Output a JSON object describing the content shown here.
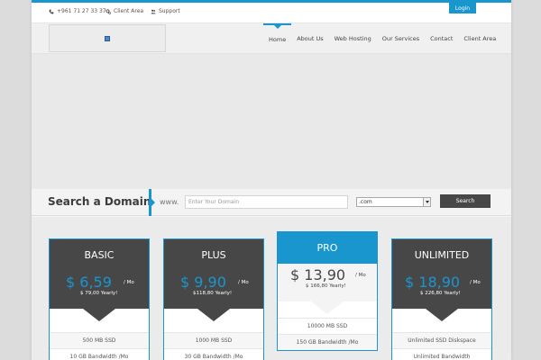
{
  "topbar": {
    "phone": "+961 71 27 33 37",
    "client_area": "Client Area",
    "support": "Support",
    "login": "Login"
  },
  "nav": {
    "items": [
      "Home",
      "About Us",
      "Web Hosting",
      "Our Services",
      "Contact",
      "Client Area"
    ],
    "active": "Home"
  },
  "domain_search": {
    "title": "Search a Domain",
    "prefix": "www.",
    "placeholder": "Enter Your Domain",
    "tld": ".com",
    "button": "Search"
  },
  "plans": [
    {
      "name": "BASIC",
      "price": "$ 6,59",
      "period": "/ Mo",
      "yearly": "$ 79,00 Yearly!",
      "features": [
        "500 MB SSD",
        "10 GB Bandwidth /Mo"
      ]
    },
    {
      "name": "PLUS",
      "price": "$ 9,90",
      "period": "/ Mo",
      "yearly": "$118,80 Yearly!",
      "features": [
        "1000 MB SSD",
        "30 GB Bandwidth /Mo"
      ]
    },
    {
      "name": "PRO",
      "price": "$ 13,90",
      "period": "/ Mo",
      "yearly": "$ 166,80 Yearly!",
      "features": [
        "10000 MB SSD",
        "150 GB Bandwidth /Mo"
      ]
    },
    {
      "name": "UNLIMITED",
      "price": "$ 18,90",
      "period": "/ Mo",
      "yearly": "$ 226,80 Yearly!",
      "features": [
        "Unlimited SSD Diskspace",
        "Unlimited Bandwidth"
      ]
    }
  ],
  "colors": {
    "accent": "#1a96cf",
    "dark": "#474747"
  },
  "icons": {
    "phone": "phone-icon",
    "client_area": "gears-icon",
    "support": "users-icon"
  }
}
